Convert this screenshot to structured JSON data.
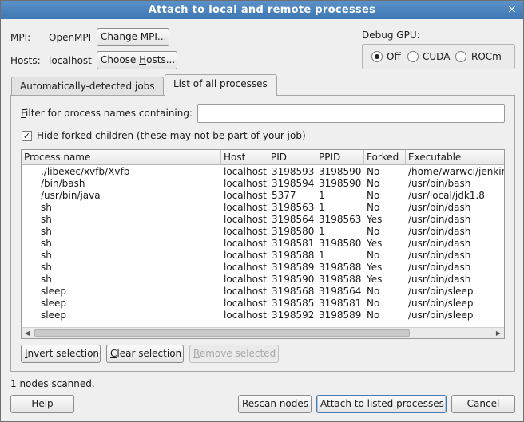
{
  "window": {
    "title": "Attach to local and remote processes",
    "close_glyph": "×"
  },
  "mpi": {
    "label": "MPI:",
    "value": "OpenMPI",
    "button_pre": "",
    "button_ul": "C",
    "button_post": "hange MPI..."
  },
  "hosts": {
    "label": "Hosts:",
    "value": "localhost",
    "button_pre": "Choose ",
    "button_ul": "H",
    "button_post": "osts..."
  },
  "debug_gpu": {
    "label": "Debug GPU:",
    "options": [
      {
        "label": "Off",
        "checked": true
      },
      {
        "label": "CUDA",
        "checked": false
      },
      {
        "label": "ROCm",
        "checked": false
      }
    ]
  },
  "tabs": [
    {
      "label": "Automatically-detected jobs",
      "active": false
    },
    {
      "label": "List of all processes",
      "active": true
    }
  ],
  "filter": {
    "label_ul": "F",
    "label_rest": "ilter for process names containing:",
    "value": ""
  },
  "hide_forked": {
    "checked": true,
    "checkmark": "✓",
    "label_pre": "Hide forked children (these may not be part of ",
    "label_ul": "y",
    "label_post": "our job)"
  },
  "table": {
    "columns": [
      "Process name",
      "Host",
      "PID",
      "PPID",
      "Forked",
      "Executable"
    ],
    "rows": [
      [
        "./libexec/xvfb/Xvfb",
        "localhost",
        "3198593",
        "3198590",
        "No",
        "/home/warwci/jenkins"
      ],
      [
        "/bin/bash",
        "localhost",
        "3198594",
        "3198590",
        "No",
        "/usr/bin/bash"
      ],
      [
        "/usr/bin/java",
        "localhost",
        "5377",
        "1",
        "No",
        "/usr/local/jdk1.8"
      ],
      [
        "sh",
        "localhost",
        "3198563",
        "1",
        "No",
        "/usr/bin/dash"
      ],
      [
        "sh",
        "localhost",
        "3198564",
        "3198563",
        "Yes",
        "/usr/bin/dash"
      ],
      [
        "sh",
        "localhost",
        "3198580",
        "1",
        "No",
        "/usr/bin/dash"
      ],
      [
        "sh",
        "localhost",
        "3198581",
        "3198580",
        "Yes",
        "/usr/bin/dash"
      ],
      [
        "sh",
        "localhost",
        "3198588",
        "1",
        "No",
        "/usr/bin/dash"
      ],
      [
        "sh",
        "localhost",
        "3198589",
        "3198588",
        "Yes",
        "/usr/bin/dash"
      ],
      [
        "sh",
        "localhost",
        "3198590",
        "3198588",
        "Yes",
        "/usr/bin/dash"
      ],
      [
        "sleep",
        "localhost",
        "3198568",
        "3198564",
        "No",
        "/usr/bin/sleep"
      ],
      [
        "sleep",
        "localhost",
        "3198585",
        "3198581",
        "No",
        "/usr/bin/sleep"
      ],
      [
        "sleep",
        "localhost",
        "3198592",
        "3198589",
        "No",
        "/usr/bin/sleep"
      ]
    ],
    "scroll_left_glyph": "◀",
    "scroll_right_glyph": "▶"
  },
  "selection_buttons": {
    "invert": {
      "ul": "I",
      "rest": "nvert selection"
    },
    "clear": {
      "ul": "C",
      "rest": "lear selection"
    },
    "remove": {
      "ul": "R",
      "rest": "emove selected"
    }
  },
  "status": "1 nodes scanned.",
  "footer": {
    "help": {
      "ul": "H",
      "rest": "elp"
    },
    "rescan": {
      "pre": "Rescan ",
      "ul": "n",
      "post": "odes"
    },
    "attach": "Attach to listed processes",
    "cancel": "Cancel"
  },
  "colors": {
    "titlebar": "#3d77b3",
    "window_bg": "#efefef"
  }
}
